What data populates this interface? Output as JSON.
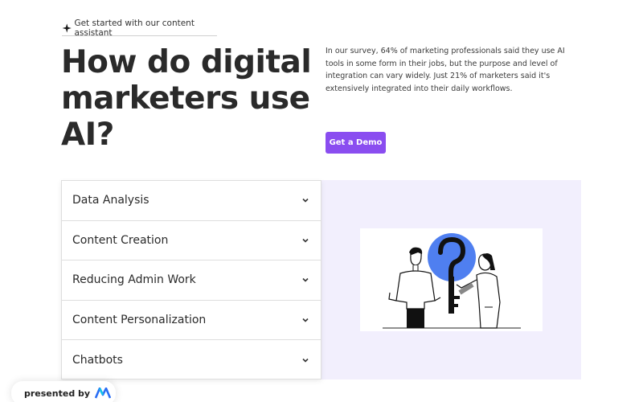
{
  "eyebrow": {
    "icon": "sparkle-icon",
    "text": "Get started with our content assistant"
  },
  "headline": "How do digital marketers use AI?",
  "intro": "In our survey, 64% of marketing professionals said they use AI tools in some form in their jobs, but the purpose and level of integration can vary widely. Just 21% of marketers said it's extensively integrated into their daily workflows.",
  "cta": {
    "label": "Get a Demo",
    "color": "#8a4df0"
  },
  "accordion": {
    "items": [
      {
        "label": "Data Analysis"
      },
      {
        "label": "Content Creation"
      },
      {
        "label": "Reducing Admin Work"
      },
      {
        "label": "Content Personalization"
      },
      {
        "label": "Chatbots"
      }
    ],
    "icon": "chevron-down-icon"
  },
  "illustration": {
    "icon": "question-key-people-illustration",
    "accent": "#4f7ff0"
  },
  "panel": {
    "background": "#f2effd"
  },
  "badge": {
    "text": "presented by",
    "icon": "brand-logo-icon"
  }
}
